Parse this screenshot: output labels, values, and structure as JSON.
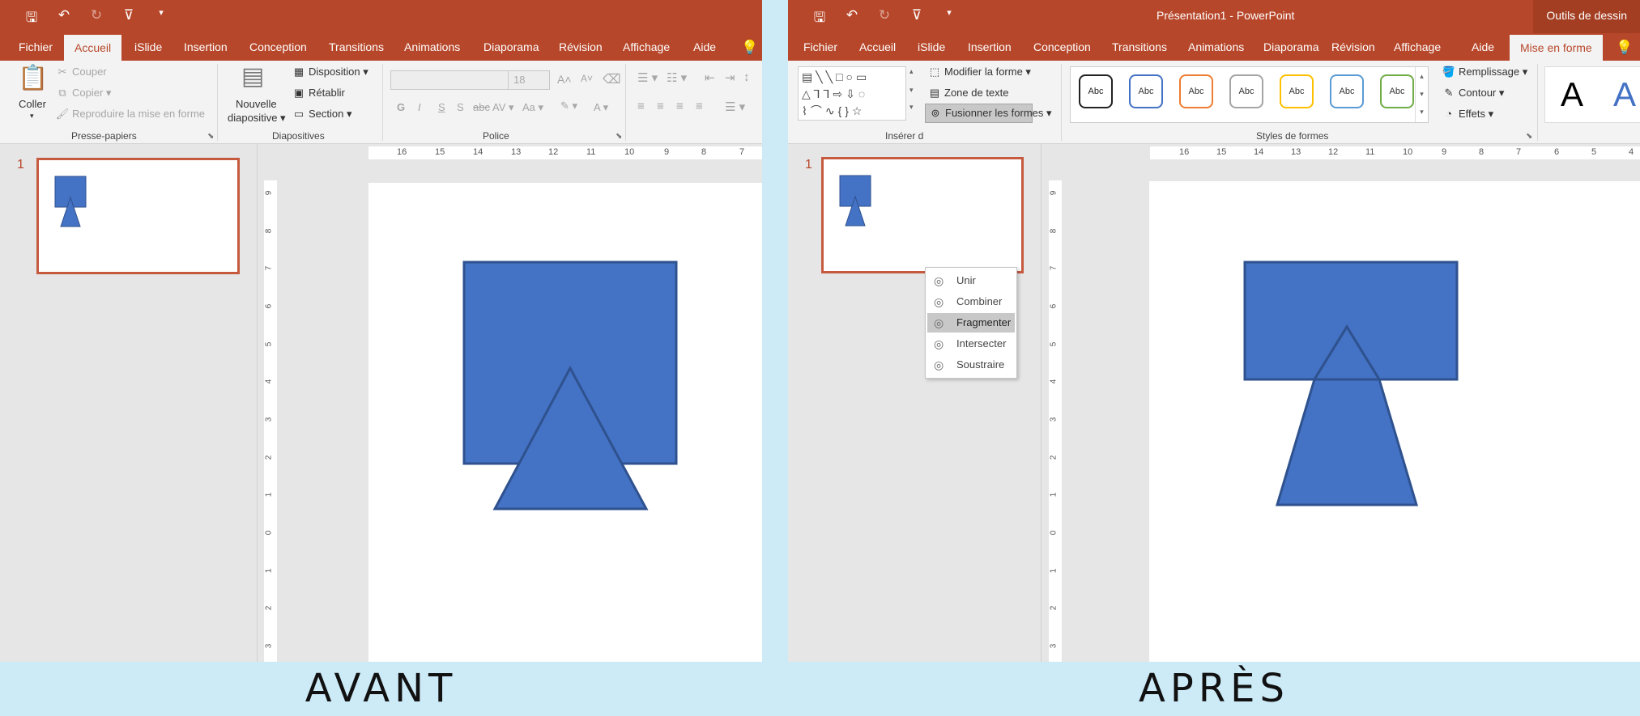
{
  "colors": {
    "accent": "#b7472a",
    "shape_fill": "#4472c4",
    "shape_stroke": "#2f528f"
  },
  "before": {
    "caption": "AVANT",
    "quick_access": [
      "save-icon",
      "undo-icon",
      "redo-icon",
      "present-icon",
      "customize-icon"
    ],
    "tabs": [
      "Fichier",
      "Accueil",
      "iSlide",
      "Insertion",
      "Conception",
      "Transitions",
      "Animations",
      "Diaporama",
      "Révision",
      "Affichage",
      "Aide"
    ],
    "active_tab": "Accueil",
    "clipboard": {
      "paste": "Coller",
      "cut": "Couper",
      "copy": "Copier",
      "format_painter": "Reproduire la mise en forme",
      "label": "Presse-papiers"
    },
    "slides_group": {
      "new_slide_l1": "Nouvelle",
      "new_slide_l2": "diapositive",
      "layout": "Disposition",
      "reset": "Rétablir",
      "section": "Section",
      "label": "Diapositives"
    },
    "font_group": {
      "font_size": "18",
      "grow": "A˄",
      "shrink": "A˅",
      "bold": "G",
      "italic": "I",
      "underline": "S",
      "shadow": "S",
      "strikethrough": "abc",
      "spacing": "AV",
      "case": "Aa",
      "color": "A",
      "label": "Police"
    },
    "slide_number": "1",
    "ruler_h": [
      "16",
      "15",
      "14",
      "13",
      "12",
      "11",
      "10",
      "9",
      "8",
      "7"
    ],
    "ruler_v": [
      "9",
      "8",
      "7",
      "6",
      "5",
      "4",
      "3",
      "2",
      "1",
      "0",
      "1",
      "2",
      "3"
    ]
  },
  "after": {
    "caption": "APRÈS",
    "window_title": "Présentation1 - PowerPoint",
    "context_label": "Outils de dessin",
    "tabs": [
      "Fichier",
      "Accueil",
      "iSlide",
      "Insertion",
      "Conception",
      "Transitions",
      "Animations",
      "Diaporama",
      "Révision",
      "Affichage",
      "Aide",
      "Mise en forme"
    ],
    "active_tab": "Mise en forme",
    "insert_shapes": {
      "edit_shape": "Modifier la forme",
      "text_box": "Zone de texte",
      "merge_shapes": "Fusionner les formes",
      "label": "Insérer d"
    },
    "shape_styles": {
      "swatch": "Abc",
      "fill": "Remplissage",
      "outline": "Contour",
      "effects": "Effets",
      "label": "Styles de formes"
    },
    "wordart": "A",
    "merge_menu": [
      "Unir",
      "Combiner",
      "Fragmenter",
      "Intersecter",
      "Soustraire"
    ],
    "highlighted": "Fragmenter",
    "slide_number": "1",
    "ruler_h": [
      "16",
      "15",
      "14",
      "13",
      "12",
      "11",
      "10",
      "9",
      "8",
      "7",
      "6",
      "5",
      "4"
    ],
    "ruler_v": [
      "9",
      "8",
      "7",
      "6",
      "5",
      "4",
      "3",
      "2",
      "1",
      "0",
      "1",
      "2",
      "3"
    ]
  }
}
